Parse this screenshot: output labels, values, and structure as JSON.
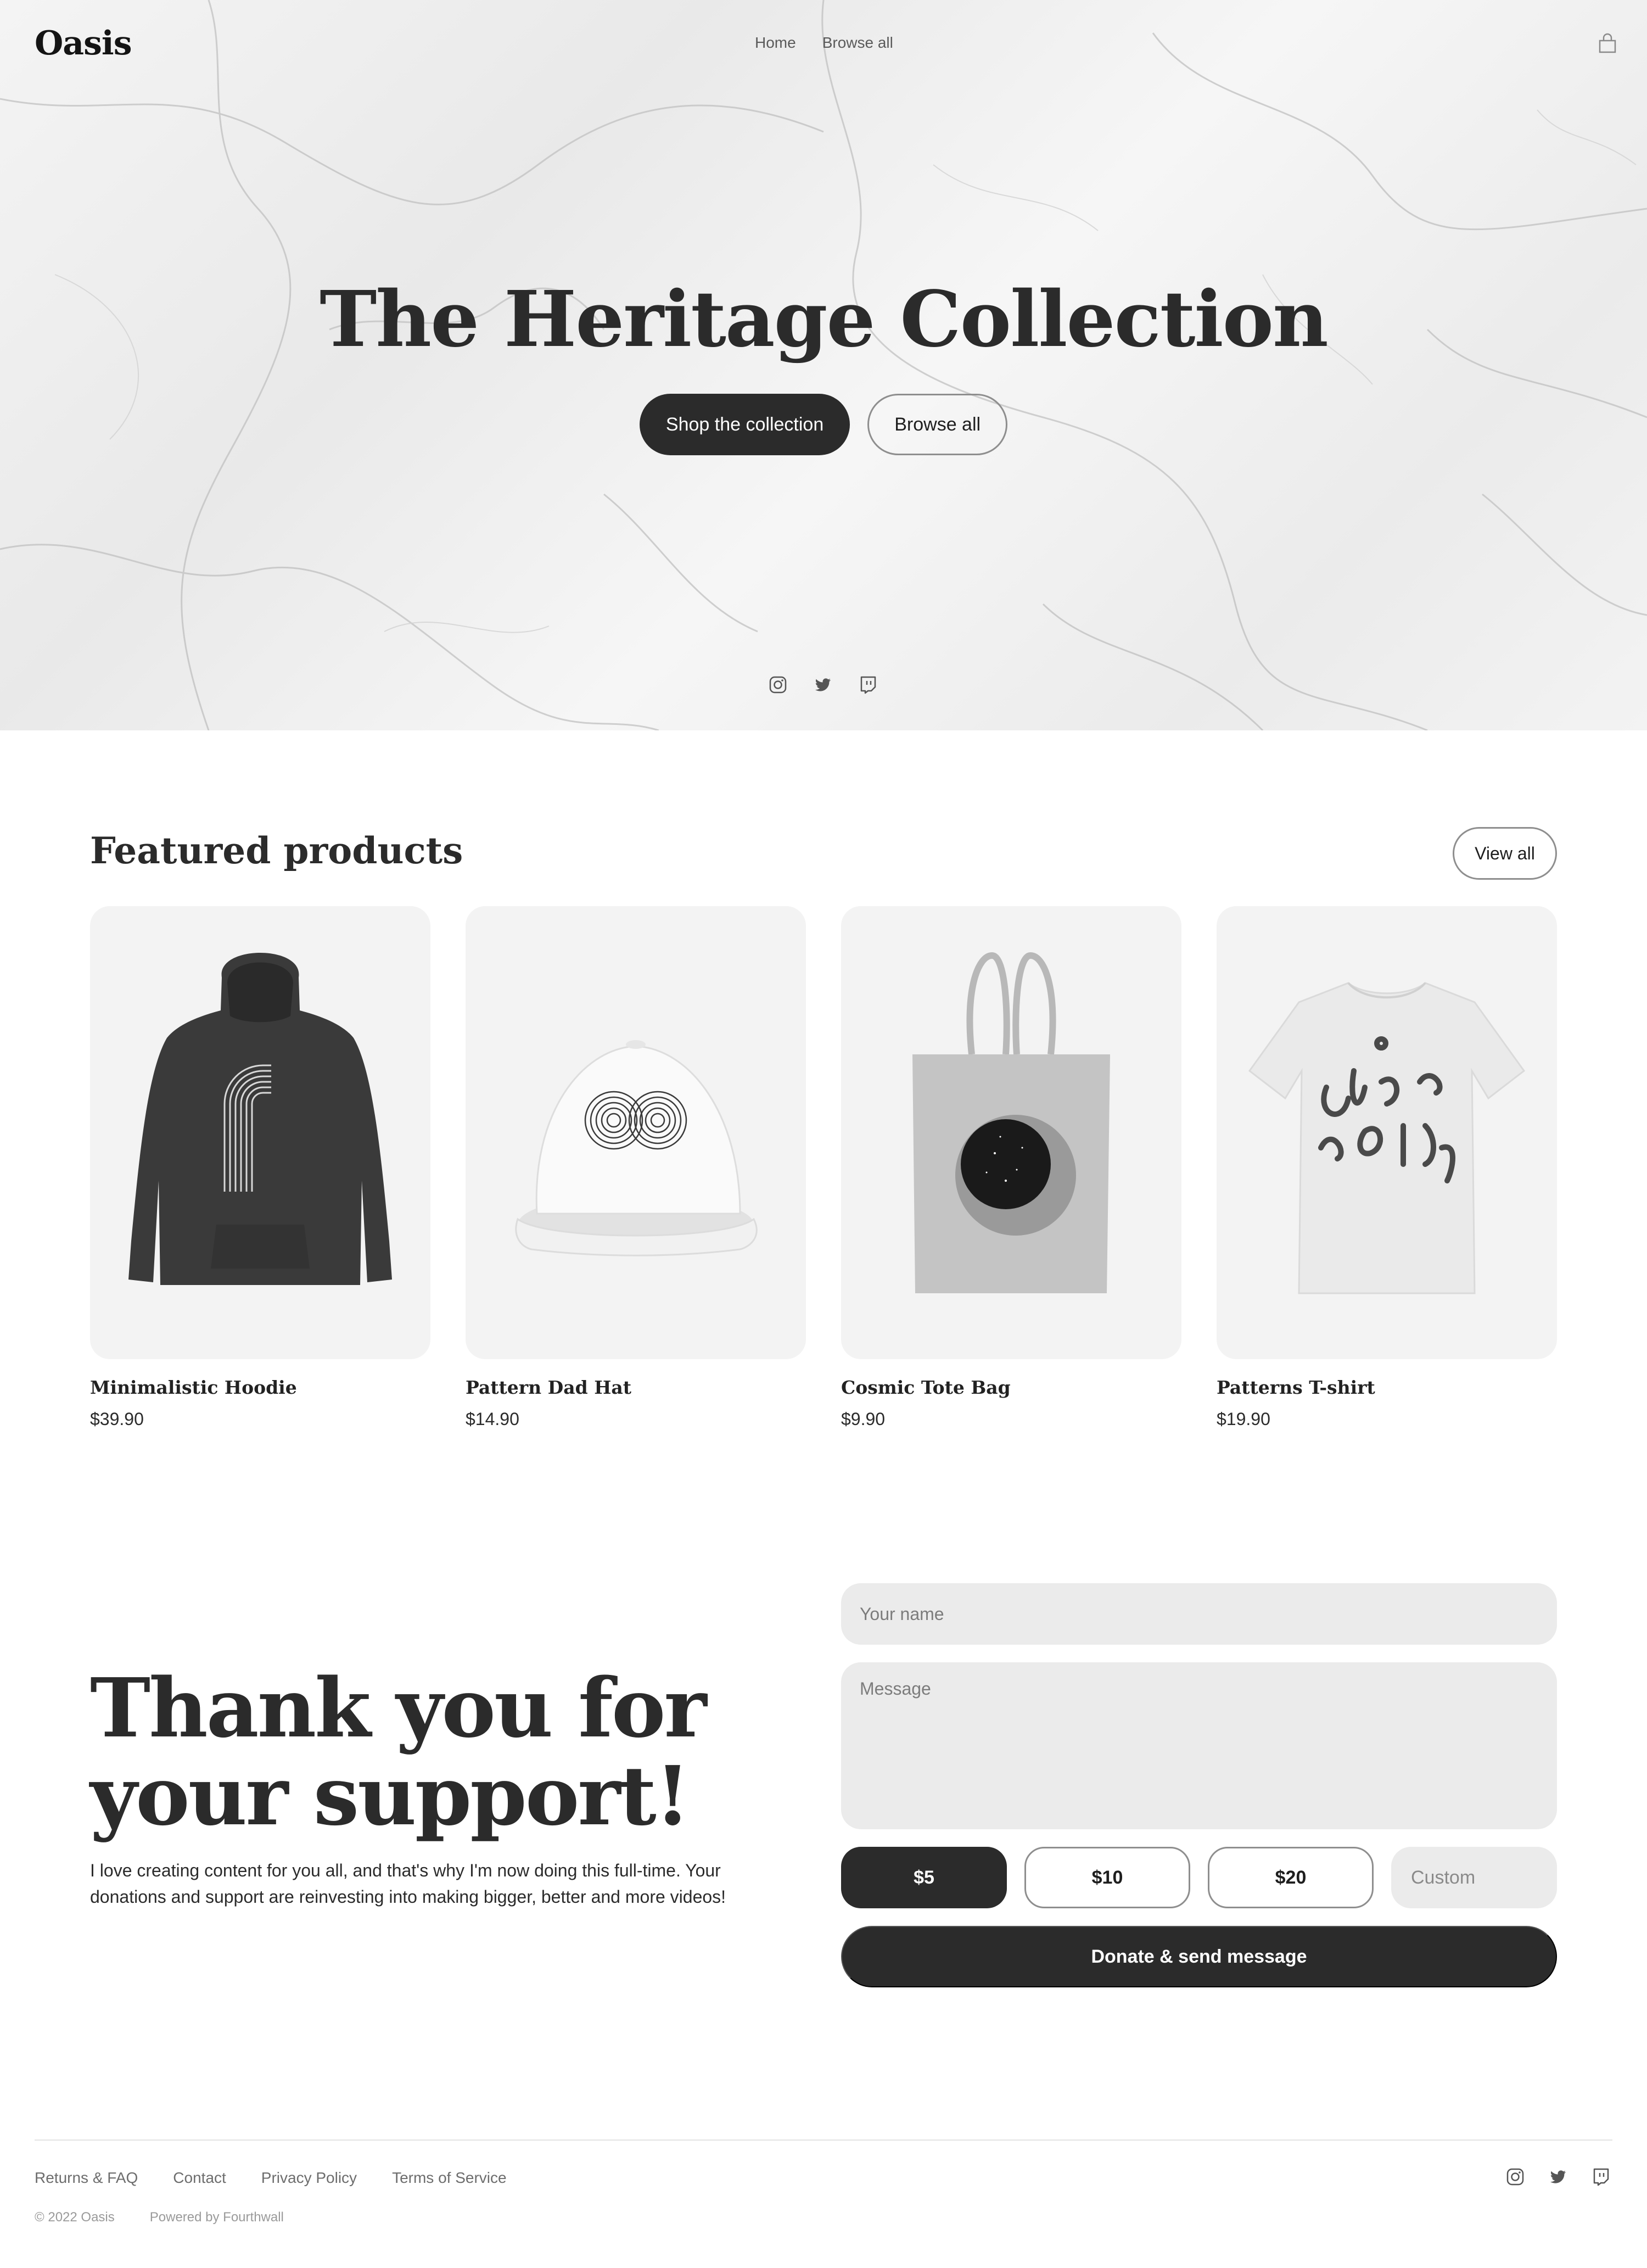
{
  "header": {
    "logo": "Oasis",
    "nav": [
      "Home",
      "Browse all"
    ],
    "cart_icon": "shopping-bag-icon"
  },
  "hero": {
    "title": "The Heritage Collection",
    "primary_button": "Shop the collection",
    "secondary_button": "Browse all",
    "social_icons": [
      "instagram-icon",
      "twitter-icon",
      "twitch-icon"
    ]
  },
  "featured": {
    "title": "Featured products",
    "view_all": "View all",
    "products": [
      {
        "name": "Minimalistic Hoodie",
        "price": "$39.90",
        "image": "black hoodie with white line pattern"
      },
      {
        "name": "Pattern Dad Hat",
        "price": "$14.90",
        "image": "white cap with circular line pattern"
      },
      {
        "name": "Cosmic Tote Bag",
        "price": "$9.90",
        "image": "gray tote bag with dark circle print"
      },
      {
        "name": "Patterns T-shirt",
        "price": "$19.90",
        "image": "white t-shirt with squiggle pattern"
      }
    ]
  },
  "support": {
    "heading": "Thank you for your support!",
    "text": "I love creating content for you all, and that's why I'm now doing this full-time. Your donations and support are reinvesting into making bigger, better and more videos!",
    "name_placeholder": "Your name",
    "message_placeholder": "Message",
    "amounts": [
      "$5",
      "$10",
      "$20"
    ],
    "selected_amount": "$5",
    "custom_placeholder": "Custom",
    "donate_button": "Donate & send message"
  },
  "footer": {
    "links": [
      "Returns & FAQ",
      "Contact",
      "Privacy Policy",
      "Terms of Service"
    ],
    "copyright": "© 2022 Oasis",
    "powered_by": "Powered by Fourthwall",
    "social_icons": [
      "instagram-icon",
      "twitter-icon",
      "twitch-icon"
    ]
  },
  "colors": {
    "dark": "#2b2b2b",
    "input_bg": "#ebebeb",
    "card_bg": "#f3f3f3",
    "outline": "#8e8e8e"
  }
}
